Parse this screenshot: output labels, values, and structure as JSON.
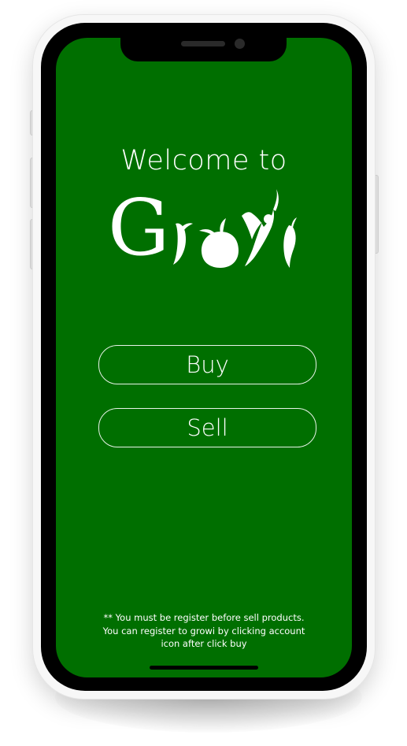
{
  "app": {
    "name": "Growi"
  },
  "welcome": {
    "text": "Welcome to",
    "logo_text": "Growi",
    "logo_initial": "G"
  },
  "actions": {
    "buy_label": "Buy",
    "sell_label": "Sell"
  },
  "footer": {
    "note_line1": "** You must be register before sell products.",
    "note_line2": "You can register to growi by clicking account",
    "note_line3": "icon after click buy"
  },
  "colors": {
    "background": "#006f00",
    "foreground": "#ffffff",
    "bezel": "#000000"
  }
}
